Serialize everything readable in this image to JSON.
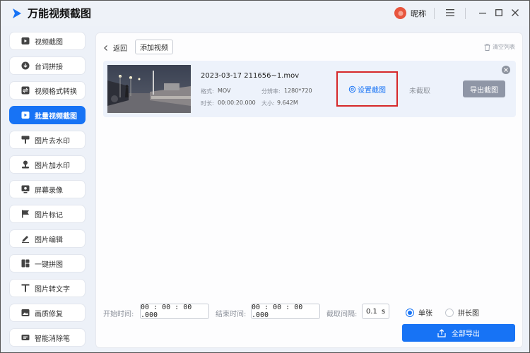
{
  "app": {
    "title": "万能视频截图",
    "nickname": "昵称"
  },
  "sidebar": {
    "items": [
      {
        "label": "视频截图",
        "icon": "video-icon"
      },
      {
        "label": "台词拼接",
        "icon": "subtitle-icon"
      },
      {
        "label": "视频格式转换",
        "icon": "convert-icon"
      },
      {
        "label": "批量视频截图",
        "icon": "batch-video-icon",
        "active": true
      },
      {
        "label": "图片去水印",
        "icon": "remove-watermark-icon"
      },
      {
        "label": "图片加水印",
        "icon": "add-watermark-icon"
      },
      {
        "label": "屏幕录像",
        "icon": "screen-record-icon"
      },
      {
        "label": "图片标记",
        "icon": "flag-icon"
      },
      {
        "label": "图片编辑",
        "icon": "edit-icon"
      },
      {
        "label": "一键拼图",
        "icon": "collage-icon"
      },
      {
        "label": "图片转文字",
        "icon": "text-icon"
      },
      {
        "label": "画质修复",
        "icon": "image-repair-icon"
      },
      {
        "label": "智能消除笔",
        "icon": "eraser-icon"
      }
    ]
  },
  "toolbar": {
    "back_label": "返回",
    "add_video_label": "添加视频",
    "clear_list_label": "清空列表"
  },
  "video": {
    "file_name": "2023-03-17 211656~1.mov",
    "format_label": "格式:",
    "format_value": "MOV",
    "resolution_label": "分辨率:",
    "resolution_value": "1280*720",
    "duration_label": "时长:",
    "duration_value": "00:00:20.000",
    "size_label": "大小:",
    "size_value": "9.642M",
    "set_capture_label": "设置截图",
    "status": "未截取",
    "export_label": "导出截图"
  },
  "controls": {
    "start_label": "开始时间:",
    "start_value": "00 : 00 : 00 .000",
    "end_label": "结束时间:",
    "end_value": "00 : 00 : 00 .000",
    "interval_label": "截取间隔:",
    "interval_value": "0.1",
    "interval_unit": "s",
    "mode_single": "单张",
    "mode_long": "拼长图",
    "selected_mode": "单张",
    "export_all_label": "全部导出"
  },
  "colors": {
    "accent": "#1773f5",
    "highlight_box": "#d6282a",
    "export_disabled": "#8f96a6"
  }
}
